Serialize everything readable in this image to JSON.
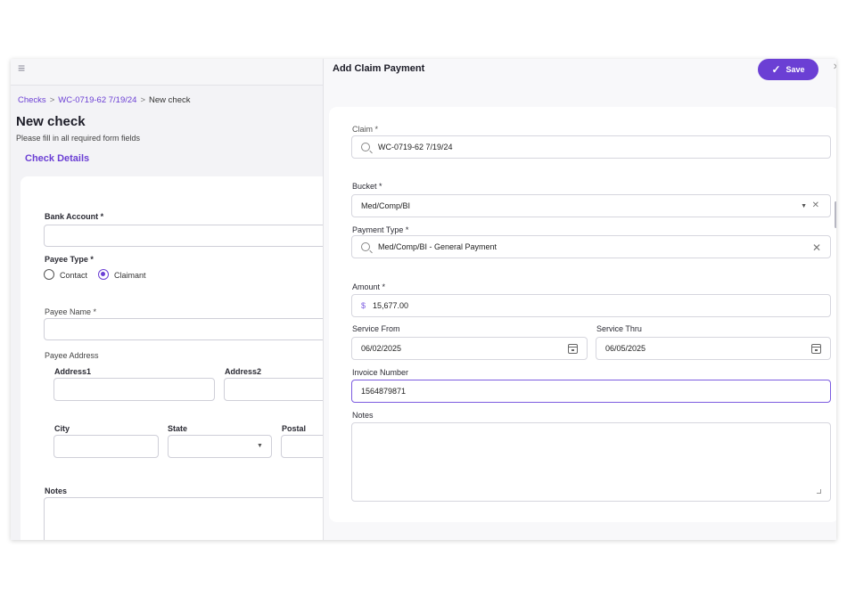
{
  "background_page": {
    "breadcrumb": [
      "Checks",
      "WC-0719-62 7/19/24",
      "New check"
    ],
    "title": "New check",
    "subtitle": "Please fill in all required form fields",
    "section_tab": "Check Details",
    "fields": {
      "bank_account": "Bank Account  *",
      "payee_type": "Payee Type *",
      "payee_type_options": [
        "Contact",
        "Claimant"
      ],
      "payee_type_selected": "Claimant",
      "payee_name": "Payee Name  *",
      "payee_address": "Payee Address",
      "address1": "Address1",
      "address2": "Address2",
      "city": "City",
      "state": "State",
      "postal": "Postal",
      "notes": "Notes"
    }
  },
  "panel": {
    "title": "Add Claim Payment",
    "save_label": "Save",
    "claim": {
      "label": "Claim  *",
      "value": "WC-0719-62 7/19/24"
    },
    "bucket": {
      "label": "Bucket  *",
      "value": "Med/Comp/BI"
    },
    "payment_type": {
      "label": "Payment Type  *",
      "value": "Med/Comp/BI - General Payment"
    },
    "amount": {
      "label": "Amount  *",
      "currency": "$",
      "value": "15,677.00"
    },
    "service_from": {
      "label": "Service From",
      "value": "06/02/2025"
    },
    "service_thru": {
      "label": "Service Thru",
      "value": "06/05/2025"
    },
    "invoice_number": {
      "label": "Invoice Number",
      "value": "1564879871"
    },
    "notes": {
      "label": "Notes",
      "value": ""
    }
  },
  "colors": {
    "accent": "#6b3fd4",
    "focus_border": "#7c5ce0",
    "page_bg": "#f3f3f6"
  },
  "icons": [
    "menu-icon",
    "search-icon",
    "chevron-down-icon",
    "clear-icon",
    "calendar-icon",
    "check-icon",
    "close-icon",
    "resize-handle-icon"
  ]
}
